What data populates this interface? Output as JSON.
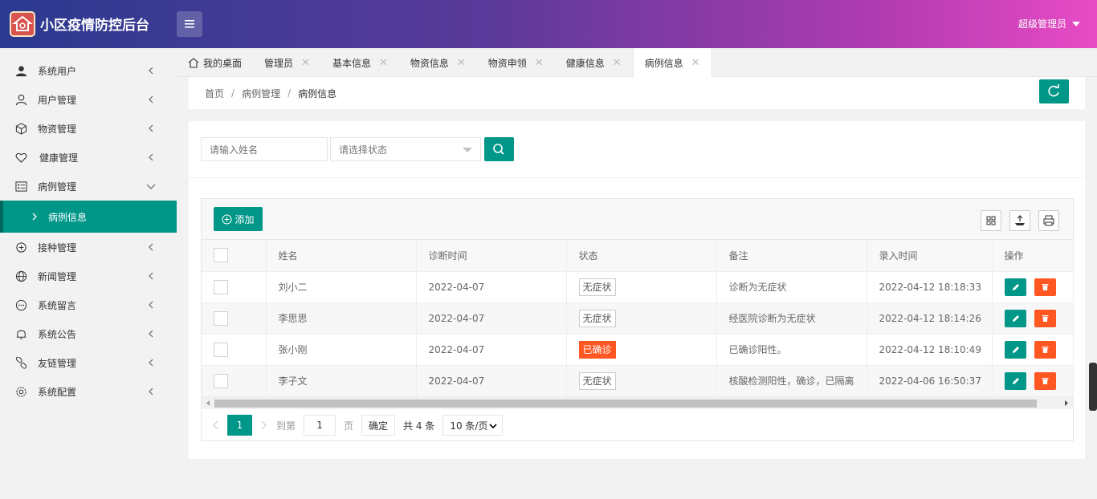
{
  "header": {
    "title": "小区疫情防控后台",
    "user": "超级管理员"
  },
  "sidebar": {
    "items": [
      {
        "label": "系统用户",
        "icon": "user-solid-icon"
      },
      {
        "label": "用户管理",
        "icon": "user-icon"
      },
      {
        "label": "物资管理",
        "icon": "cube-icon"
      },
      {
        "label": "健康管理",
        "icon": "heart-icon"
      },
      {
        "label": "病例管理",
        "icon": "list-icon",
        "expanded": true
      },
      {
        "label": "接种管理",
        "icon": "syringe-icon"
      },
      {
        "label": "新闻管理",
        "icon": "globe-icon"
      },
      {
        "label": "系统留言",
        "icon": "message-icon"
      },
      {
        "label": "系统公告",
        "icon": "bell-icon"
      },
      {
        "label": "友链管理",
        "icon": "link-icon"
      },
      {
        "label": "系统配置",
        "icon": "gear-icon"
      }
    ],
    "active_sub": "病例信息"
  },
  "tabs": [
    {
      "label": "我的桌面",
      "closable": false
    },
    {
      "label": "管理员",
      "closable": true
    },
    {
      "label": "基本信息",
      "closable": true
    },
    {
      "label": "物资信息",
      "closable": true
    },
    {
      "label": "物资申领",
      "closable": true
    },
    {
      "label": "健康信息",
      "closable": true
    },
    {
      "label": "病例信息",
      "closable": true,
      "active": true
    }
  ],
  "breadcrumb": [
    "首页",
    "病例管理",
    "病例信息"
  ],
  "search": {
    "name_placeholder": "请输入姓名",
    "status_placeholder": "请选择状态"
  },
  "toolbar": {
    "add_label": "添加"
  },
  "table": {
    "columns": [
      "姓名",
      "诊断时间",
      "状态",
      "备注",
      "录入时间",
      "操作"
    ],
    "rows": [
      {
        "name": "刘小二",
        "diag": "2022-04-07",
        "status": "无症状",
        "status_type": "normal",
        "note": "诊断为无症状",
        "created": "2022-04-12 18:18:33"
      },
      {
        "name": "李思思",
        "diag": "2022-04-07",
        "status": "无症状",
        "status_type": "normal",
        "note": "经医院诊断为无症状",
        "created": "2022-04-12 18:14:26"
      },
      {
        "name": "张小刚",
        "diag": "2022-04-07",
        "status": "已确诊",
        "status_type": "danger",
        "note": "已确诊阳性。",
        "created": "2022-04-12 18:10:49"
      },
      {
        "name": "李子文",
        "diag": "2022-04-07",
        "status": "无症状",
        "status_type": "normal",
        "note": "核酸检测阳性，确诊，已隔离",
        "created": "2022-04-06 16:50:37"
      }
    ]
  },
  "pager": {
    "current": "1",
    "goto_label": "到第",
    "goto_value": "1",
    "page_label": "页",
    "confirm": "确定",
    "total": "共 4 条",
    "page_size": "10 条/页"
  },
  "colors": {
    "primary": "#009688",
    "danger": "#ff5722"
  }
}
